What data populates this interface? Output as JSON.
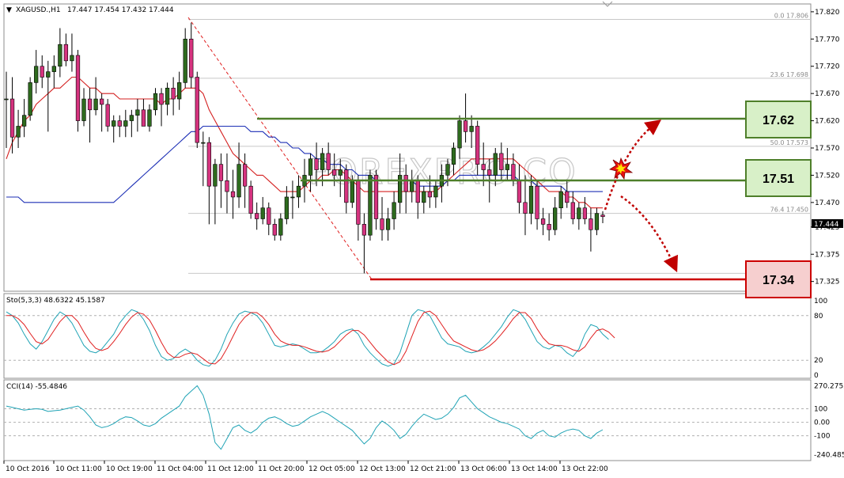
{
  "colors": {
    "bull": "#2e6b1e",
    "bear": "#d6337f",
    "ma_red": "#d42020",
    "ma_blue": "#1c2fb5",
    "stoch_main": "#1fa3b5",
    "stoch_signal": "#e02020",
    "cci": "#1fa3b5",
    "green_level": "#4e7f2a",
    "red_level": "#cc0000",
    "green_box_fill": "#d8f0c8",
    "red_box_fill": "#f6cfcf",
    "arrow": "#c00000"
  },
  "header": {
    "symbol": "XAGUSD.,H1",
    "ohlc": "17.447 17.454 17.432 17.444"
  },
  "watermark": "FOREXPRO.CO",
  "levels": [
    {
      "label": "17.62",
      "value": 17.62,
      "color": "green"
    },
    {
      "label": "17.51",
      "value": 17.51,
      "color": "green"
    },
    {
      "label": "17.34",
      "value": 17.34,
      "color": "red"
    }
  ],
  "fib_labels": [
    {
      "text": "0.0  17.806",
      "value": 17.806
    },
    {
      "text": "23.6 17.698",
      "value": 17.698
    },
    {
      "text": "50.0 17.573",
      "value": 17.573
    },
    {
      "text": "76.4 17.450",
      "value": 17.45
    }
  ],
  "indicators": {
    "stoch_label": "Sto(5,3,3) 48.6322 45.1587",
    "cci_label": "CCI(14) -55.4846"
  },
  "chart_data": {
    "type": "candlestick",
    "instrument": "XAGUSD.,H1",
    "price_ticks": [
      "17.820",
      "17.770",
      "17.720",
      "17.670",
      "17.620",
      "17.570",
      "17.520",
      "17.470",
      "17.425",
      "17.375",
      "17.325"
    ],
    "price_ylim": [
      17.31,
      17.83
    ],
    "current_price": "17.444",
    "x_ticks": [
      "10 Oct 2016",
      "10 Oct 11:00",
      "10 Oct 19:00",
      "11 Oct 04:00",
      "11 Oct 12:00",
      "11 Oct 20:00",
      "12 Oct 05:00",
      "12 Oct 13:00",
      "12 Oct 21:00",
      "13 Oct 06:00",
      "13 Oct 14:00",
      "13 Oct 22:00"
    ],
    "candles": [
      {
        "o": 17.66,
        "h": 17.71,
        "l": 17.57,
        "c": 17.66
      },
      {
        "o": 17.66,
        "h": 17.7,
        "l": 17.56,
        "c": 17.59
      },
      {
        "o": 17.59,
        "h": 17.64,
        "l": 17.57,
        "c": 17.61
      },
      {
        "o": 17.61,
        "h": 17.66,
        "l": 17.59,
        "c": 17.63
      },
      {
        "o": 17.63,
        "h": 17.7,
        "l": 17.62,
        "c": 17.69
      },
      {
        "o": 17.69,
        "h": 17.75,
        "l": 17.67,
        "c": 17.72
      },
      {
        "o": 17.72,
        "h": 17.74,
        "l": 17.68,
        "c": 17.7
      },
      {
        "o": 17.7,
        "h": 17.73,
        "l": 17.6,
        "c": 17.71
      },
      {
        "o": 17.71,
        "h": 17.74,
        "l": 17.68,
        "c": 17.72
      },
      {
        "o": 17.72,
        "h": 17.79,
        "l": 17.7,
        "c": 17.76
      },
      {
        "o": 17.76,
        "h": 17.78,
        "l": 17.72,
        "c": 17.73
      },
      {
        "o": 17.73,
        "h": 17.78,
        "l": 17.71,
        "c": 17.74
      },
      {
        "o": 17.74,
        "h": 17.75,
        "l": 17.6,
        "c": 17.62
      },
      {
        "o": 17.62,
        "h": 17.68,
        "l": 17.61,
        "c": 17.66
      },
      {
        "o": 17.66,
        "h": 17.68,
        "l": 17.58,
        "c": 17.64
      },
      {
        "o": 17.64,
        "h": 17.7,
        "l": 17.63,
        "c": 17.66
      },
      {
        "o": 17.66,
        "h": 17.67,
        "l": 17.6,
        "c": 17.65
      },
      {
        "o": 17.65,
        "h": 17.66,
        "l": 17.6,
        "c": 17.61
      },
      {
        "o": 17.61,
        "h": 17.63,
        "l": 17.58,
        "c": 17.62
      },
      {
        "o": 17.62,
        "h": 17.63,
        "l": 17.59,
        "c": 17.61
      },
      {
        "o": 17.61,
        "h": 17.64,
        "l": 17.59,
        "c": 17.62
      },
      {
        "o": 17.62,
        "h": 17.64,
        "l": 17.59,
        "c": 17.63
      },
      {
        "o": 17.63,
        "h": 17.66,
        "l": 17.6,
        "c": 17.64
      },
      {
        "o": 17.64,
        "h": 17.66,
        "l": 17.61,
        "c": 17.61
      },
      {
        "o": 17.61,
        "h": 17.65,
        "l": 17.6,
        "c": 17.64
      },
      {
        "o": 17.64,
        "h": 17.68,
        "l": 17.63,
        "c": 17.67
      },
      {
        "o": 17.67,
        "h": 17.68,
        "l": 17.61,
        "c": 17.65
      },
      {
        "o": 17.65,
        "h": 17.69,
        "l": 17.63,
        "c": 17.68
      },
      {
        "o": 17.68,
        "h": 17.7,
        "l": 17.63,
        "c": 17.66
      },
      {
        "o": 17.66,
        "h": 17.71,
        "l": 17.64,
        "c": 17.69
      },
      {
        "o": 17.69,
        "h": 17.79,
        "l": 17.68,
        "c": 17.77
      },
      {
        "o": 17.77,
        "h": 17.8,
        "l": 17.68,
        "c": 17.7
      },
      {
        "o": 17.7,
        "h": 17.71,
        "l": 17.57,
        "c": 17.58
      },
      {
        "o": 17.58,
        "h": 17.6,
        "l": 17.5,
        "c": 17.58
      },
      {
        "o": 17.58,
        "h": 17.59,
        "l": 17.43,
        "c": 17.5
      },
      {
        "o": 17.5,
        "h": 17.55,
        "l": 17.43,
        "c": 17.54
      },
      {
        "o": 17.54,
        "h": 17.56,
        "l": 17.46,
        "c": 17.51
      },
      {
        "o": 17.51,
        "h": 17.56,
        "l": 17.45,
        "c": 17.49
      },
      {
        "o": 17.49,
        "h": 17.53,
        "l": 17.44,
        "c": 17.48
      },
      {
        "o": 17.48,
        "h": 17.58,
        "l": 17.46,
        "c": 17.54
      },
      {
        "o": 17.54,
        "h": 17.56,
        "l": 17.46,
        "c": 17.5
      },
      {
        "o": 17.5,
        "h": 17.51,
        "l": 17.44,
        "c": 17.45
      },
      {
        "o": 17.45,
        "h": 17.47,
        "l": 17.42,
        "c": 17.44
      },
      {
        "o": 17.44,
        "h": 17.48,
        "l": 17.43,
        "c": 17.46
      },
      {
        "o": 17.46,
        "h": 17.47,
        "l": 17.41,
        "c": 17.43
      },
      {
        "o": 17.43,
        "h": 17.44,
        "l": 17.4,
        "c": 17.41
      },
      {
        "o": 17.41,
        "h": 17.45,
        "l": 17.4,
        "c": 17.44
      },
      {
        "o": 17.44,
        "h": 17.5,
        "l": 17.43,
        "c": 17.48
      },
      {
        "o": 17.48,
        "h": 17.51,
        "l": 17.44,
        "c": 17.48
      },
      {
        "o": 17.48,
        "h": 17.52,
        "l": 17.46,
        "c": 17.5
      },
      {
        "o": 17.5,
        "h": 17.55,
        "l": 17.47,
        "c": 17.52
      },
      {
        "o": 17.52,
        "h": 17.56,
        "l": 17.49,
        "c": 17.55
      },
      {
        "o": 17.55,
        "h": 17.58,
        "l": 17.5,
        "c": 17.53
      },
      {
        "o": 17.53,
        "h": 17.57,
        "l": 17.5,
        "c": 17.56
      },
      {
        "o": 17.56,
        "h": 17.58,
        "l": 17.52,
        "c": 17.53
      },
      {
        "o": 17.53,
        "h": 17.56,
        "l": 17.5,
        "c": 17.52
      },
      {
        "o": 17.52,
        "h": 17.55,
        "l": 17.48,
        "c": 17.53
      },
      {
        "o": 17.53,
        "h": 17.54,
        "l": 17.45,
        "c": 17.47
      },
      {
        "o": 17.47,
        "h": 17.52,
        "l": 17.46,
        "c": 17.51
      },
      {
        "o": 17.51,
        "h": 17.52,
        "l": 17.4,
        "c": 17.43
      },
      {
        "o": 17.43,
        "h": 17.45,
        "l": 17.34,
        "c": 17.41
      },
      {
        "o": 17.41,
        "h": 17.53,
        "l": 17.4,
        "c": 17.52
      },
      {
        "o": 17.52,
        "h": 17.53,
        "l": 17.42,
        "c": 17.44
      },
      {
        "o": 17.44,
        "h": 17.48,
        "l": 17.4,
        "c": 17.42
      },
      {
        "o": 17.42,
        "h": 17.46,
        "l": 17.4,
        "c": 17.44
      },
      {
        "o": 17.44,
        "h": 17.49,
        "l": 17.42,
        "c": 17.47
      },
      {
        "o": 17.47,
        "h": 17.56,
        "l": 17.45,
        "c": 17.52
      },
      {
        "o": 17.52,
        "h": 17.54,
        "l": 17.45,
        "c": 17.49
      },
      {
        "o": 17.49,
        "h": 17.53,
        "l": 17.47,
        "c": 17.51
      },
      {
        "o": 17.51,
        "h": 17.52,
        "l": 17.44,
        "c": 17.47
      },
      {
        "o": 17.47,
        "h": 17.5,
        "l": 17.45,
        "c": 17.49
      },
      {
        "o": 17.49,
        "h": 17.52,
        "l": 17.46,
        "c": 17.48
      },
      {
        "o": 17.48,
        "h": 17.51,
        "l": 17.46,
        "c": 17.5
      },
      {
        "o": 17.5,
        "h": 17.54,
        "l": 17.47,
        "c": 17.52
      },
      {
        "o": 17.52,
        "h": 17.55,
        "l": 17.5,
        "c": 17.54
      },
      {
        "o": 17.54,
        "h": 17.58,
        "l": 17.52,
        "c": 17.57
      },
      {
        "o": 17.57,
        "h": 17.63,
        "l": 17.55,
        "c": 17.62
      },
      {
        "o": 17.62,
        "h": 17.67,
        "l": 17.58,
        "c": 17.6
      },
      {
        "o": 17.6,
        "h": 17.63,
        "l": 17.57,
        "c": 17.61
      },
      {
        "o": 17.61,
        "h": 17.62,
        "l": 17.52,
        "c": 17.54
      },
      {
        "o": 17.54,
        "h": 17.58,
        "l": 17.5,
        "c": 17.53
      },
      {
        "o": 17.53,
        "h": 17.55,
        "l": 17.47,
        "c": 17.52
      },
      {
        "o": 17.52,
        "h": 17.57,
        "l": 17.5,
        "c": 17.56
      },
      {
        "o": 17.56,
        "h": 17.58,
        "l": 17.51,
        "c": 17.53
      },
      {
        "o": 17.53,
        "h": 17.57,
        "l": 17.51,
        "c": 17.54
      },
      {
        "o": 17.54,
        "h": 17.56,
        "l": 17.5,
        "c": 17.51
      },
      {
        "o": 17.51,
        "h": 17.54,
        "l": 17.45,
        "c": 17.47
      },
      {
        "o": 17.47,
        "h": 17.52,
        "l": 17.41,
        "c": 17.45
      },
      {
        "o": 17.45,
        "h": 17.52,
        "l": 17.43,
        "c": 17.5
      },
      {
        "o": 17.5,
        "h": 17.51,
        "l": 17.42,
        "c": 17.44
      },
      {
        "o": 17.44,
        "h": 17.46,
        "l": 17.41,
        "c": 17.43
      },
      {
        "o": 17.43,
        "h": 17.45,
        "l": 17.4,
        "c": 17.42
      },
      {
        "o": 17.42,
        "h": 17.48,
        "l": 17.41,
        "c": 17.46
      },
      {
        "o": 17.46,
        "h": 17.5,
        "l": 17.44,
        "c": 17.49
      },
      {
        "o": 17.49,
        "h": 17.51,
        "l": 17.46,
        "c": 17.47
      },
      {
        "o": 17.47,
        "h": 17.49,
        "l": 17.43,
        "c": 17.44
      },
      {
        "o": 17.44,
        "h": 17.47,
        "l": 17.42,
        "c": 17.46
      },
      {
        "o": 17.46,
        "h": 17.48,
        "l": 17.43,
        "c": 17.44
      },
      {
        "o": 17.44,
        "h": 17.46,
        "l": 17.38,
        "c": 17.42
      },
      {
        "o": 17.42,
        "h": 17.46,
        "l": 17.41,
        "c": 17.45
      },
      {
        "o": 17.447,
        "h": 17.454,
        "l": 17.432,
        "c": 17.444
      }
    ],
    "ma_fast": [
      17.55,
      17.58,
      17.6,
      17.62,
      17.63,
      17.65,
      17.66,
      17.67,
      17.68,
      17.68,
      17.69,
      17.7,
      17.7,
      17.69,
      17.68,
      17.68,
      17.67,
      17.67,
      17.67,
      17.66,
      17.66,
      17.66,
      17.66,
      17.66,
      17.66,
      17.66,
      17.65,
      17.66,
      17.66,
      17.67,
      17.68,
      17.68,
      17.68,
      17.67,
      17.64,
      17.62,
      17.6,
      17.58,
      17.56,
      17.55,
      17.54,
      17.53,
      17.52,
      17.52,
      17.51,
      17.5,
      17.49,
      17.49,
      17.49,
      17.49,
      17.5,
      17.51,
      17.51,
      17.52,
      17.52,
      17.53,
      17.53,
      17.52,
      17.51,
      17.5,
      17.49,
      17.49,
      17.49,
      17.49,
      17.49,
      17.49,
      17.49,
      17.49,
      17.49,
      17.49,
      17.49,
      17.49,
      17.49,
      17.5,
      17.51,
      17.52,
      17.53,
      17.54,
      17.55,
      17.55,
      17.55,
      17.55,
      17.55,
      17.55,
      17.55,
      17.55,
      17.54,
      17.53,
      17.52,
      17.51,
      17.5,
      17.49,
      17.49,
      17.49,
      17.48,
      17.48,
      17.47,
      17.47,
      17.46,
      17.46,
      17.46
    ],
    "ma_slow": [
      17.48,
      17.48,
      17.48,
      17.47,
      17.47,
      17.47,
      17.47,
      17.47,
      17.47,
      17.47,
      17.47,
      17.47,
      17.47,
      17.47,
      17.47,
      17.47,
      17.47,
      17.47,
      17.47,
      17.48,
      17.49,
      17.5,
      17.51,
      17.52,
      17.53,
      17.54,
      17.55,
      17.56,
      17.57,
      17.58,
      17.59,
      17.6,
      17.6,
      17.61,
      17.61,
      17.61,
      17.61,
      17.61,
      17.61,
      17.61,
      17.61,
      17.6,
      17.6,
      17.6,
      17.59,
      17.59,
      17.58,
      17.58,
      17.57,
      17.57,
      17.56,
      17.56,
      17.55,
      17.55,
      17.54,
      17.54,
      17.54,
      17.53,
      17.53,
      17.52,
      17.52,
      17.52,
      17.51,
      17.51,
      17.51,
      17.51,
      17.51,
      17.51,
      17.51,
      17.5,
      17.5,
      17.5,
      17.5,
      17.5,
      17.51,
      17.51,
      17.52,
      17.52,
      17.52,
      17.52,
      17.52,
      17.52,
      17.52,
      17.52,
      17.52,
      17.52,
      17.51,
      17.51,
      17.51,
      17.5,
      17.5,
      17.5,
      17.5,
      17.5,
      17.49,
      17.49,
      17.49,
      17.49,
      17.49,
      17.49,
      17.49
    ],
    "stochastic": {
      "ticks": [
        "100",
        "80",
        "20",
        "0"
      ],
      "levels": [
        80,
        20
      ],
      "ylim": [
        0,
        100
      ],
      "main": [
        85,
        80,
        70,
        55,
        42,
        35,
        45,
        60,
        75,
        85,
        80,
        70,
        55,
        40,
        32,
        30,
        35,
        45,
        55,
        70,
        80,
        88,
        85,
        75,
        60,
        40,
        25,
        20,
        22,
        30,
        35,
        30,
        20,
        14,
        12,
        20,
        35,
        55,
        70,
        82,
        86,
        84,
        80,
        70,
        55,
        40,
        38,
        40,
        42,
        40,
        35,
        30,
        30,
        32,
        38,
        45,
        55,
        60,
        62,
        55,
        40,
        30,
        22,
        15,
        12,
        15,
        30,
        55,
        80,
        88,
        86,
        80,
        65,
        50,
        42,
        40,
        38,
        32,
        30,
        32,
        38,
        45,
        55,
        65,
        78,
        88,
        85,
        75,
        60,
        45,
        38,
        35,
        40,
        38,
        30,
        25,
        35,
        55,
        68,
        65,
        55,
        48
      ],
      "signal": [
        80,
        80,
        76,
        68,
        56,
        45,
        42,
        48,
        60,
        72,
        80,
        80,
        72,
        58,
        45,
        36,
        33,
        36,
        45,
        56,
        68,
        78,
        84,
        82,
        74,
        60,
        44,
        30,
        24,
        24,
        28,
        30,
        28,
        22,
        16,
        15,
        22,
        36,
        52,
        68,
        78,
        84,
        84,
        78,
        68,
        55,
        46,
        42,
        40,
        40,
        38,
        35,
        32,
        31,
        33,
        38,
        46,
        54,
        60,
        60,
        54,
        44,
        34,
        26,
        18,
        14,
        18,
        32,
        52,
        72,
        84,
        86,
        80,
        68,
        56,
        46,
        42,
        38,
        34,
        32,
        34,
        39,
        46,
        55,
        65,
        76,
        84,
        84,
        76,
        62,
        50,
        42,
        40,
        40,
        38,
        34,
        32,
        38,
        50,
        60,
        62,
        58,
        50
      ]
    },
    "cci": {
      "ticks": [
        "270.2752",
        "100",
        "0.00",
        "-100",
        "-240.485"
      ],
      "ylim": [
        -260,
        290
      ],
      "values": [
        120,
        110,
        100,
        90,
        95,
        100,
        95,
        80,
        85,
        90,
        100,
        110,
        120,
        90,
        40,
        -20,
        -40,
        -30,
        -10,
        20,
        40,
        35,
        10,
        -20,
        -30,
        -10,
        30,
        60,
        90,
        120,
        190,
        230,
        270,
        200,
        60,
        -150,
        -200,
        -120,
        -40,
        -20,
        -60,
        -80,
        -50,
        0,
        30,
        40,
        20,
        -10,
        -30,
        -20,
        10,
        40,
        60,
        80,
        60,
        30,
        0,
        -30,
        -60,
        -110,
        -160,
        -120,
        -40,
        10,
        -20,
        -60,
        -120,
        -90,
        -30,
        20,
        60,
        40,
        20,
        30,
        60,
        110,
        180,
        200,
        150,
        100,
        70,
        40,
        20,
        0,
        -10,
        -30,
        -50,
        -100,
        -120,
        -80,
        -60,
        -100,
        -110,
        -80,
        -60,
        -50,
        -60,
        -100,
        -120,
        -80,
        -55
      ]
    }
  }
}
